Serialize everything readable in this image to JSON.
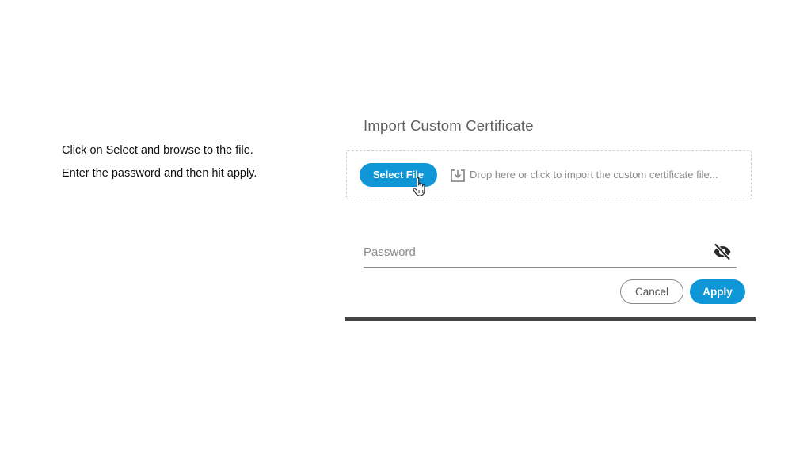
{
  "instructions": {
    "line1": "Click on Select and browse to the file.",
    "line2": "Enter the password and then hit apply."
  },
  "dialog": {
    "title": "Import Custom Certificate",
    "select_file_label": "Select File",
    "drop_text": "Drop here or click to import the custom certificate file...",
    "password_placeholder": "Password",
    "password_value": "",
    "cancel_label": "Cancel",
    "apply_label": "Apply"
  },
  "icons": {
    "drop": "download-tray-icon",
    "visibility": "eye-off-icon",
    "cursor": "hand-pointer-icon"
  },
  "colors": {
    "accent": "#0e96d6",
    "title_text": "#5f5f5f",
    "muted_text": "#8a8a8a",
    "bottom_bar": "#444444"
  }
}
